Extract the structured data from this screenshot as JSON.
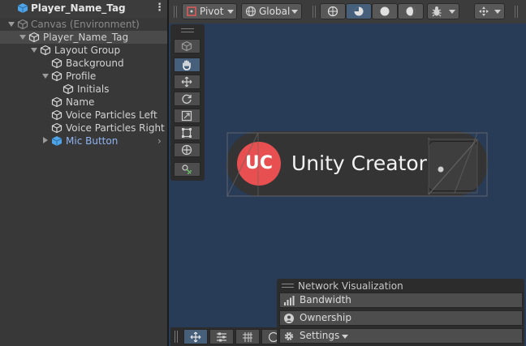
{
  "hierarchy": {
    "title": "Player_Name_Tag",
    "items": [
      {
        "label": "Canvas (Environment)"
      },
      {
        "label": "Player_Name_Tag"
      },
      {
        "label": "Layout Group"
      },
      {
        "label": "Background"
      },
      {
        "label": "Profile"
      },
      {
        "label": "Initials"
      },
      {
        "label": "Name"
      },
      {
        "label": "Voice Particles Left"
      },
      {
        "label": "Voice Particles Right"
      },
      {
        "label": "Mic Button"
      }
    ]
  },
  "toolbar": {
    "pivot_label": "Pivot",
    "global_label": "Global"
  },
  "scene": {
    "nametag": {
      "initials": "UC",
      "name": "Unity Creator",
      "profile_color": "#e84f50"
    },
    "background_color": "#283b57"
  },
  "network_visualization": {
    "title": "Network Visualization",
    "items": [
      {
        "label": "Bandwidth"
      },
      {
        "label": "Ownership"
      },
      {
        "label": "Settings"
      }
    ]
  },
  "colors": {
    "accent_blue": "#46607c",
    "prefab_text": "#8fb4f0"
  }
}
